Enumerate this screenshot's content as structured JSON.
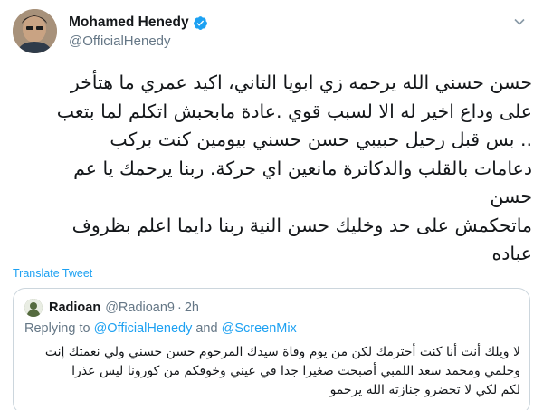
{
  "tweet": {
    "author": {
      "display_name": "Mohamed Henedy",
      "handle": "@OfficialHenedy",
      "avatar_icon": "profile-photo-avatar",
      "verified_icon": "verified-badge-icon",
      "verified_color": "#1da1f2"
    },
    "menu_icon": "chevron-down-icon",
    "body_lines": [
      "حسن حسني الله يرحمه زي ابويا التاني، اكيد عمري ما هتأخر",
      "على وداع اخير له الا لسبب قوي .عادة مابحبش اتكلم لما بتعب",
      ".. بس قبل رحيل حبيبي حسن حسني بيومين كنت بركب",
      "دعامات بالقلب والدكاترة مانعين اي حركة. ربنا يرحمك يا عم",
      "حسن",
      "ماتحكمش على حد وخليك حسن النية ربنا دايما اعلم بظروف",
      "عباده"
    ],
    "translate_label": "Translate Tweet",
    "link_color": "#1da1f2"
  },
  "quoted": {
    "display_name": "Radioan",
    "handle": "@Radioan9",
    "separator": "·",
    "time": "2h",
    "replying_prefix": "Replying to",
    "replying_user1": "@OfficialHenedy",
    "replying_and": "and",
    "replying_user2": "@ScreenMix",
    "text_lines": [
      "لا ويلك أنت أنا كنت أحترمك لكن من يوم وفاة سيدك المرحوم حسن حسني ولي نعمتك إنت",
      "وحلمي ومحمد سعد اللمبي أصبحت صغيرا جدا في عيني وخوفكم من كورونا ليس عذرا",
      "لكم لكي لا تحضرو جنازته الله يرحمو"
    ]
  }
}
